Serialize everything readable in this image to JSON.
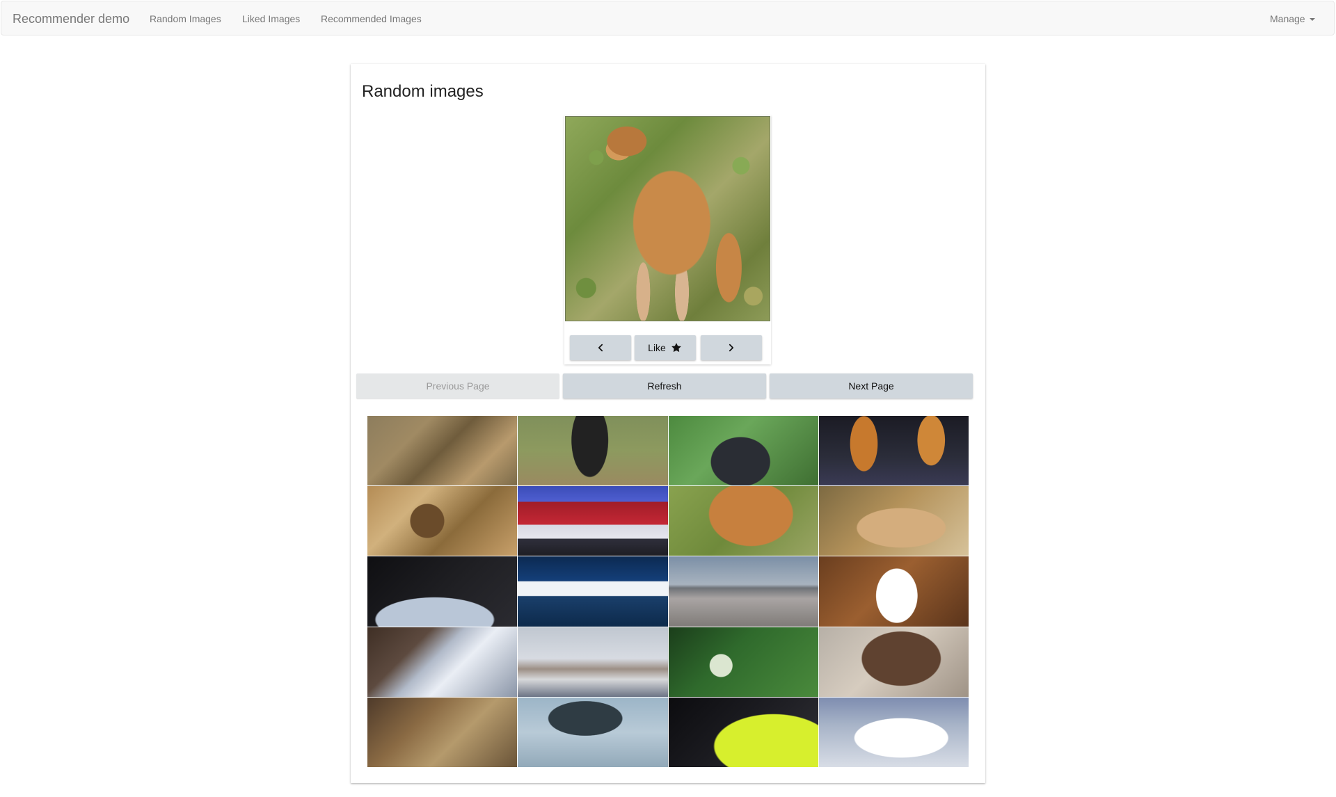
{
  "navbar": {
    "brand": "Recommender demo",
    "links": [
      {
        "label": "Random Images"
      },
      {
        "label": "Liked Images"
      },
      {
        "label": "Recommended Images"
      }
    ],
    "manage_label": "Manage"
  },
  "main": {
    "title": "Random images",
    "hero": {
      "prev_icon": "chevron-left-icon",
      "like_label": "Like",
      "like_icon": "star-icon",
      "next_icon": "chevron-right-icon"
    },
    "pager": {
      "previous_label": "Previous Page",
      "refresh_label": "Refresh",
      "next_label": "Next Page"
    },
    "grid": {
      "rows": 5,
      "columns": 4,
      "tile_count": 20
    }
  },
  "colors": {
    "navbar_bg": "#f8f8f8",
    "button_bg": "#d0d7dd",
    "disabled_bg": "#e5e7e8",
    "text": "#333333"
  }
}
